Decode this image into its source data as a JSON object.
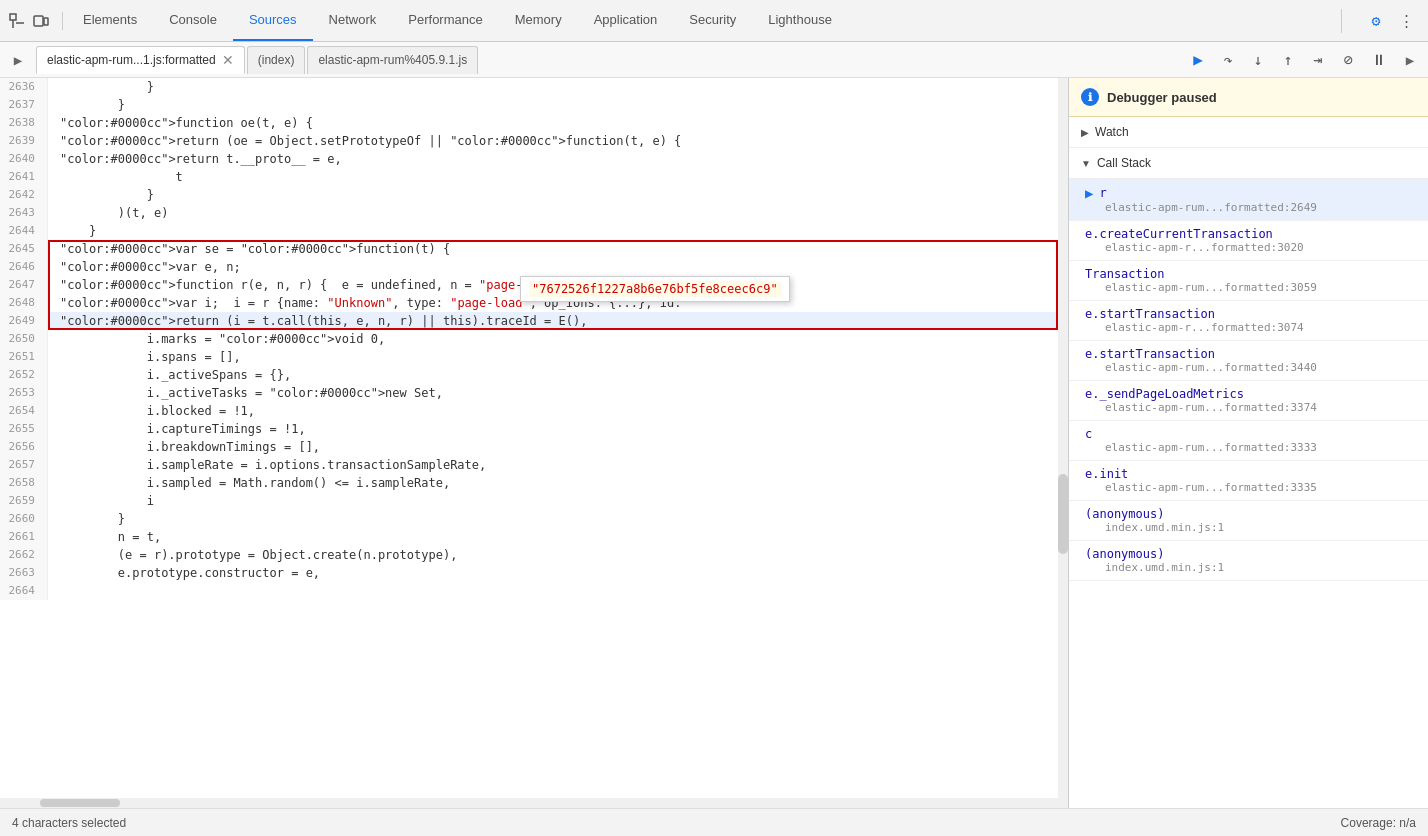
{
  "toolbar": {
    "tabs": [
      {
        "label": "Elements",
        "active": false
      },
      {
        "label": "Console",
        "active": false
      },
      {
        "label": "Sources",
        "active": true
      },
      {
        "label": "Network",
        "active": false
      },
      {
        "label": "Performance",
        "active": false
      },
      {
        "label": "Memory",
        "active": false
      },
      {
        "label": "Application",
        "active": false
      },
      {
        "label": "Security",
        "active": false
      },
      {
        "label": "Lighthouse",
        "active": false
      }
    ]
  },
  "file_tabs": [
    {
      "label": "elastic-apm-rum...1.js:formatted",
      "active": true,
      "closeable": true
    },
    {
      "label": "(index)",
      "active": false,
      "closeable": false
    },
    {
      "label": "elastic-apm-rum%405.9.1.js",
      "active": false,
      "closeable": false
    }
  ],
  "debugger": {
    "paused_text": "Debugger paused",
    "watch_label": "Watch",
    "call_stack_label": "Call Stack",
    "call_stack_items": [
      {
        "fn": "r",
        "file": "elastic-apm-rum...formatted:2649",
        "active": true
      },
      {
        "fn": "e.createCurrentTransaction",
        "file": "elastic-apm-r...formatted:3020",
        "active": false
      },
      {
        "fn": "Transaction",
        "file": "elastic-apm-rum...formatted:3059",
        "active": false
      },
      {
        "fn": "e.startTransaction",
        "file": "elastic-apm-r...formatted:3074",
        "active": false
      },
      {
        "fn": "e.startTransaction",
        "file": "elastic-apm-rum...formatted:3440",
        "active": false
      },
      {
        "fn": "e._sendPageLoadMetrics",
        "file": "elastic-apm-rum...formatted:3374",
        "active": false
      },
      {
        "fn": "c",
        "file": "elastic-apm-rum...formatted:3333",
        "active": false
      },
      {
        "fn": "e.init",
        "file": "elastic-apm-rum...formatted:3335",
        "active": false
      },
      {
        "fn": "(anonymous)",
        "file": "index.umd.min.js:1",
        "active": false
      },
      {
        "fn": "(anonymous)",
        "file": "index.umd.min.js:1",
        "active": false
      }
    ]
  },
  "code": {
    "lines": [
      {
        "num": "2636",
        "text": "            }"
      },
      {
        "num": "2637",
        "text": "        }"
      },
      {
        "num": "2638",
        "text": "        function oe(t, e) {"
      },
      {
        "num": "2639",
        "text": "            return (oe = Object.setPrototypeOf || function(t, e) {"
      },
      {
        "num": "2640",
        "text": "                return t.__proto__ = e,"
      },
      {
        "num": "2641",
        "text": "                t"
      },
      {
        "num": "2642",
        "text": "            }"
      },
      {
        "num": "2643",
        "text": "        )(t, e)"
      },
      {
        "num": "2644",
        "text": "    }"
      },
      {
        "num": "2645",
        "text": "    var se = function(t) {"
      },
      {
        "num": "2646",
        "text": "        var e, n;"
      },
      {
        "num": "2647",
        "text": "        function r(e, n, r) {  e = undefined, n = \"page-load\","
      },
      {
        "num": "2648",
        "text": "            var i;  i = r {name: \"Unknown\", type: \"page-load\", op_ions: {...}, id:"
      },
      {
        "num": "2649",
        "text": "            return (i = t.call(this, e, n, r) || this).traceId = E(),",
        "highlighted": true
      },
      {
        "num": "2650",
        "text": "            i.marks = void 0,"
      },
      {
        "num": "2651",
        "text": "            i.spans = [],"
      },
      {
        "num": "2652",
        "text": "            i._activeSpans = {},"
      },
      {
        "num": "2653",
        "text": "            i._activeTasks = new Set,"
      },
      {
        "num": "2654",
        "text": "            i.blocked = !1,"
      },
      {
        "num": "2655",
        "text": "            i.captureTimings = !1,"
      },
      {
        "num": "2656",
        "text": "            i.breakdownTimings = [],"
      },
      {
        "num": "2657",
        "text": "            i.sampleRate = i.options.transactionSampleRate,"
      },
      {
        "num": "2658",
        "text": "            i.sampled = Math.random() <= i.sampleRate,"
      },
      {
        "num": "2659",
        "text": "            i"
      },
      {
        "num": "2660",
        "text": "        }"
      },
      {
        "num": "2661",
        "text": "        n = t,"
      },
      {
        "num": "2662",
        "text": "        (e = r).prototype = Object.create(n.prototype),"
      },
      {
        "num": "2663",
        "text": "        e.prototype.constructor = e,"
      },
      {
        "num": "2664",
        "text": ""
      }
    ],
    "tooltip": {
      "value": "\"7672526f1227a8b6e76bf5fe8ceec6c9\"",
      "line": 2647
    }
  },
  "status_bar": {
    "selection_text": "4 characters selected",
    "coverage_text": "Coverage: n/a"
  }
}
